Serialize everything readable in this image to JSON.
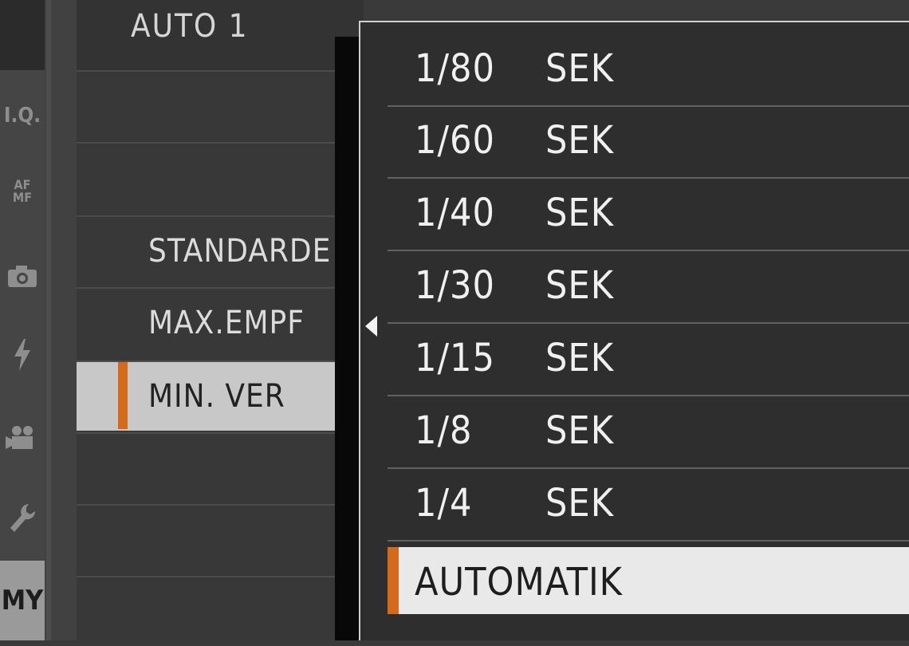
{
  "header": {
    "title": "AUTO 1"
  },
  "sidebar": {
    "tabs": [
      {
        "label": "I.Q."
      },
      {
        "label": "AF MF"
      },
      {
        "icon": "camera-icon"
      },
      {
        "icon": "flash-icon"
      },
      {
        "icon": "movie-camera-icon"
      },
      {
        "icon": "wrench-icon"
      },
      {
        "label": "MY",
        "active": true
      }
    ]
  },
  "menu": {
    "rows": [
      {
        "label": "STANDARDE"
      },
      {
        "label": "MAX.EMPF"
      },
      {
        "label": "MIN. VER",
        "selected": true
      }
    ]
  },
  "dropdown": {
    "options": [
      {
        "value": "1/80",
        "unit": "SEK"
      },
      {
        "value": "1/60",
        "unit": "SEK"
      },
      {
        "value": "1/40",
        "unit": "SEK"
      },
      {
        "value": "1/30",
        "unit": "SEK"
      },
      {
        "value": "1/15",
        "unit": "SEK"
      },
      {
        "value": "1/8",
        "unit": "SEK"
      },
      {
        "value": "1/4",
        "unit": "SEK"
      },
      {
        "value": "AUTOMATIK",
        "unit": "",
        "selected": true
      }
    ]
  },
  "colors": {
    "accent": "#d46a1c",
    "selected_bg": "#e9e9e9"
  }
}
